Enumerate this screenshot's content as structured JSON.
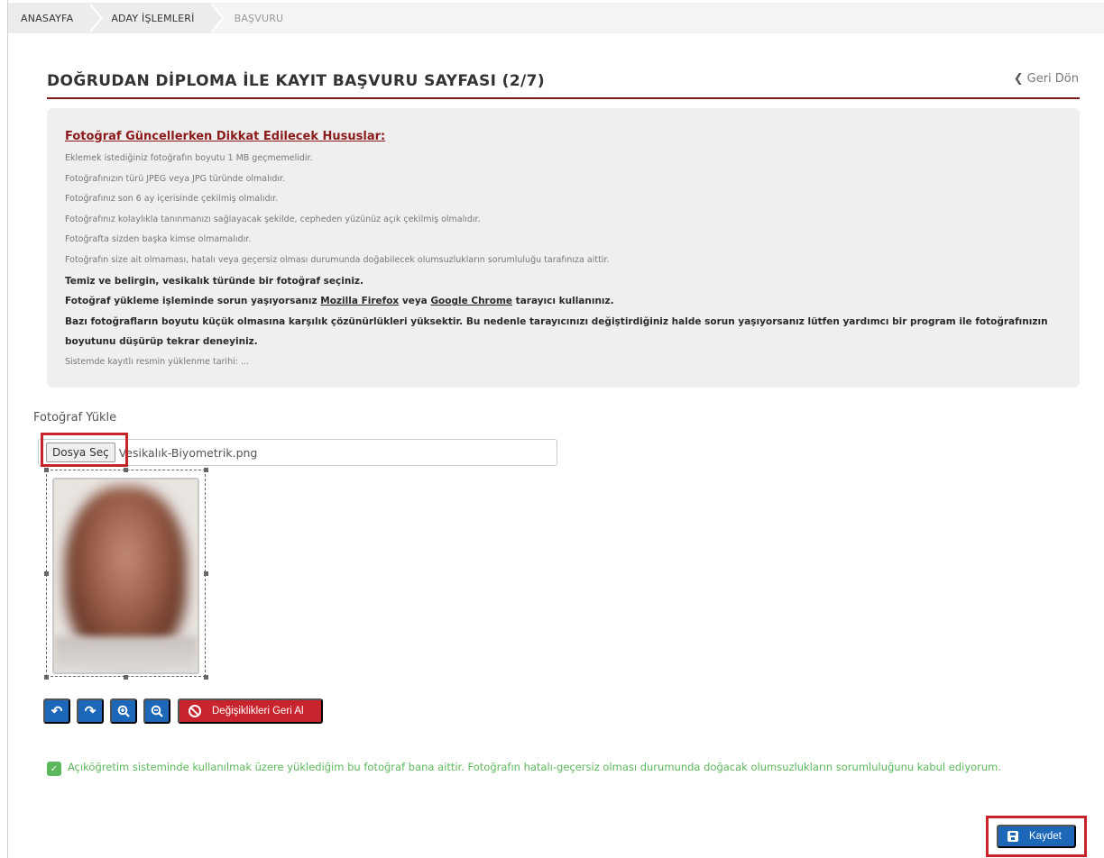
{
  "breadcrumb": [
    "ANASAYFA",
    "ADAY İŞLEMLERİ",
    "BAŞVURU"
  ],
  "header": {
    "title": "DOĞRUDAN DİPLOMA İLE KAYIT BAŞVURU SAYFASI (2/7)",
    "back_label": "Geri Dön"
  },
  "info": {
    "title": "Fotoğraf Güncellerken Dikkat Edilecek Hususlar:",
    "lines": [
      "Eklemek istediğiniz fotoğrafın boyutu 1 MB geçmemelidir.",
      "Fotoğrafınızın türü JPEG veya JPG türünde olmalıdır.",
      "Fotoğrafınız son 6 ay içerisinde çekilmiş olmalıdır.",
      "Fotoğrafınız kolaylıkla tanınmanızı sağlayacak şekilde, cepheden yüzünüz açık çekilmiş olmalıdır.",
      "Fotoğrafta sizden başka kimse olmamalıdır.",
      "Fotoğrafın size ait olmaması, hatalı veya geçersiz olması durumunda doğabilecek olumsuzlukların sorumluluğu tarafınıza aittir."
    ],
    "bold1": "Temiz ve belirgin, vesikalık türünde bir fotoğraf seçiniz.",
    "bold2_prefix": "Fotoğraf yükleme işleminde sorun yaşıyorsanız ",
    "bold2_link1": "Mozilla Firefox",
    "bold2_mid": " veya ",
    "bold2_link2": "Google Chrome",
    "bold2_suffix": " tarayıcı kullanınız.",
    "bold3a": "Bazı fotoğrafların boyutu küçük olmasına karşılık çözünürlükleri yüksektir. Bu nedenle tarayıcınızı değiştirdiğiniz halde sorun yaşıyorsanız lütfen yardımcı bir program ile fotoğrafınızın",
    "bold3b": "boyutunu düşürüp tekrar deneyiniz.",
    "last_line": "Sistemde kayıtlı resmin yüklenme tarihi: ..."
  },
  "upload": {
    "label": "Fotoğraf Yükle",
    "button_label": "Dosya Seç",
    "file_name": "Vesikalık-Biyometrik.png"
  },
  "toolbar": {
    "rotate_left_icon": "rotate-left-icon",
    "rotate_right_icon": "rotate-right-icon",
    "zoom_in_icon": "zoom-in-icon",
    "zoom_out_icon": "zoom-out-icon",
    "revert_label": "Değişiklikleri Geri Al"
  },
  "consent": {
    "checked": true,
    "text": "Açıköğretim sisteminde kullanılmak üzere yüklediğim bu fotoğraf bana aittir. Fotoğrafın hatalı-geçersiz olması durumunda doğacak olumsuzlukların sorumluluğunu kabul ediyorum."
  },
  "save_label": "Kaydet",
  "colors": {
    "primary": "#1c67b8",
    "danger": "#c8242d",
    "success": "#5cb85c",
    "title_rule": "#7a1a1a",
    "highlight": "#c7232b"
  }
}
